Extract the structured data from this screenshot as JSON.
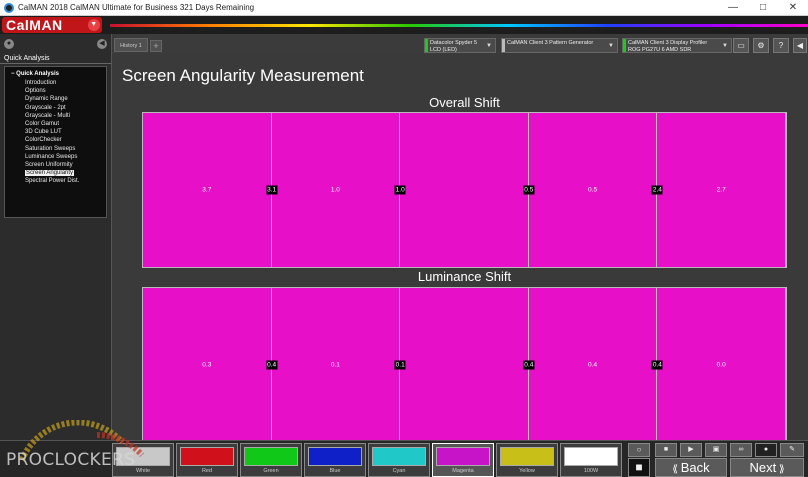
{
  "window": {
    "title": "CalMAN 2018 CalMAN Ultimate for Business 321 Days Remaining",
    "buttons": [
      "—",
      "□",
      "✕"
    ]
  },
  "logo": {
    "text": "CalMAN"
  },
  "sidebar": {
    "title": "Quick Analysis",
    "root": "Quick Analysis",
    "items": [
      "Introduction",
      "Options",
      "Dynamic Range",
      "Grayscale - 2pt",
      "Grayscale - Multi",
      "Color Gamut",
      "3D Cube LUT",
      "ColorChecker",
      "Saturation Sweeps",
      "Luminance Sweeps",
      "Screen Uniformity",
      "Screen Angularity",
      "Spectral Power Dist."
    ],
    "selected_index": 11
  },
  "tabs": {
    "active": "History 1",
    "add": "+"
  },
  "devices": [
    {
      "line1": "Datacolor Spyder 5",
      "line2": "LCD (LED)",
      "dot_color": "#1ec81e"
    },
    {
      "line1": "CalMAN Client 3 Pattern Generator",
      "line2": "",
      "dot_color": "#bbbbbb"
    },
    {
      "line1": "CalMAN Client 3 Display Profiler",
      "line2": "ROG PG27U 6 AMD SDR",
      "dot_color": "#1ec81e"
    }
  ],
  "toolbar_icons": [
    "monitor-icon",
    "gear-icon",
    "help-icon",
    "back-icon"
  ],
  "main": {
    "page_title": "Screen Angularity Measurement",
    "overall": {
      "title": "Overall Shift",
      "cell_values": [
        "3.7",
        "1.0",
        "",
        "0.5",
        "2.7"
      ],
      "boundary_values": [
        "3.1",
        "1.0",
        "0.5",
        "2.4"
      ]
    },
    "luminance": {
      "title": "Luminance Shift",
      "cell_values": [
        "0.3",
        "0.1",
        "",
        "0.4",
        "0.0"
      ],
      "boundary_values": [
        "0.4",
        "0.1",
        "0.4",
        "0.4"
      ]
    },
    "grid_color": "#e80fc8"
  },
  "swatches": [
    {
      "label": "White",
      "color": "#c8c8c8"
    },
    {
      "label": "Red",
      "color": "#d0101a"
    },
    {
      "label": "Green",
      "color": "#10c818"
    },
    {
      "label": "Blue",
      "color": "#1020c8"
    },
    {
      "label": "Cyan",
      "color": "#20c8c8"
    },
    {
      "label": "Magenta",
      "color": "#c814c8"
    },
    {
      "label": "Yellow",
      "color": "#c8c018"
    },
    {
      "label": "100W",
      "color": "#ffffff"
    }
  ],
  "selected_swatch": 5,
  "nav": {
    "back": "Back",
    "next": "Next"
  },
  "watermark": {
    "text": "PROCLOCKERS"
  }
}
